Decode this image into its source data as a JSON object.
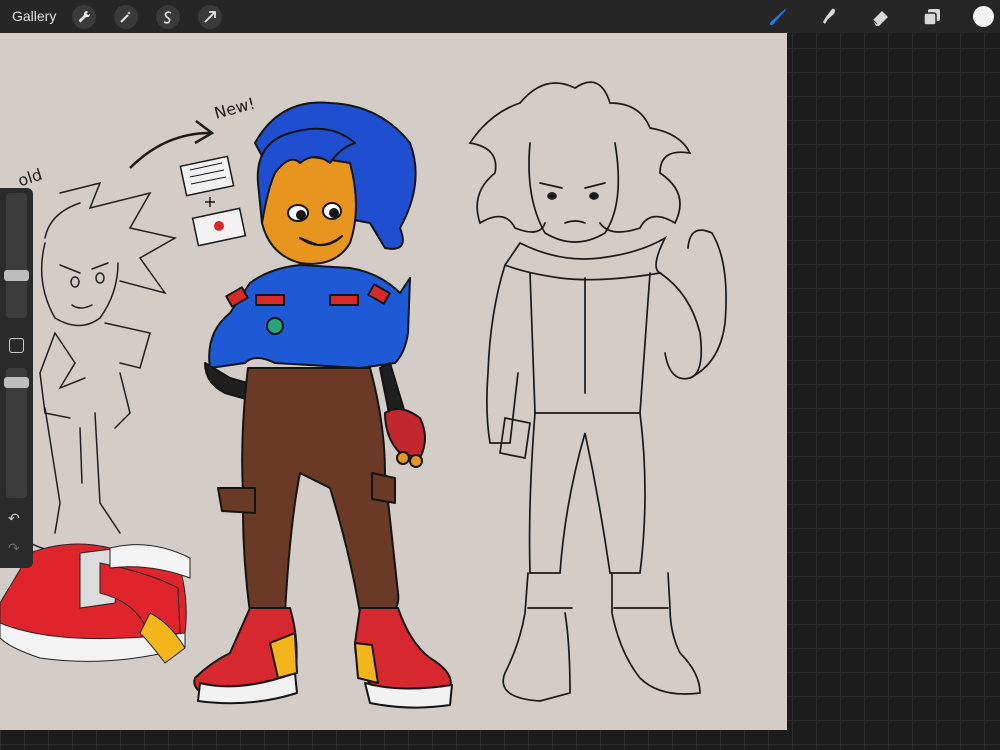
{
  "app": {
    "gallery_label": "Gallery"
  },
  "toolbar_left": [
    "wrench-icon",
    "magic-wand-icon",
    "selection-icon",
    "transform-arrow-icon"
  ],
  "toolbar_right": [
    "brush-icon",
    "smudge-icon",
    "eraser-icon",
    "layers-icon",
    "color-swatch"
  ],
  "colors": {
    "accent": "#1e7bf2",
    "canvas": "#d4cdc7",
    "workspace": "#1c1c1c",
    "active_color": "#f4f4f4"
  },
  "artwork": {
    "note_old": "old",
    "note_new": "New!"
  }
}
